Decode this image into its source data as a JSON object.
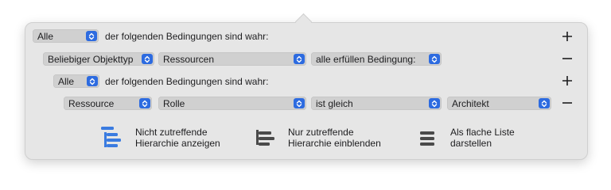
{
  "rows": [
    {
      "quantifier": "Alle",
      "suffix": "der folgenden Bedingungen sind wahr:"
    },
    {
      "field1": "Beliebiger Objekttyp",
      "field2": "Ressourcen",
      "field3": "alle erfüllen Bedingung:"
    },
    {
      "quantifier": "Alle",
      "suffix": "der folgenden Bedingungen sind wahr:"
    },
    {
      "field1": "Ressource",
      "field2": "Rolle",
      "field3": "ist gleich",
      "field4": "Architekt"
    }
  ],
  "bottom": [
    {
      "line1": "Nicht zutreffende",
      "line2": "Hierarchie anzeigen",
      "icon": "hierarchy-show-icon"
    },
    {
      "line1": "Nur zutreffende",
      "line2": "Hierarchie einblenden",
      "icon": "hierarchy-collapse-icon"
    },
    {
      "line1": "Als flache Liste",
      "line2": "darstellen",
      "icon": "flat-list-icon"
    }
  ],
  "colors": {
    "accent": "#2d6be0",
    "panel": "#e6e6e6",
    "popup": "#d0d0d0"
  }
}
